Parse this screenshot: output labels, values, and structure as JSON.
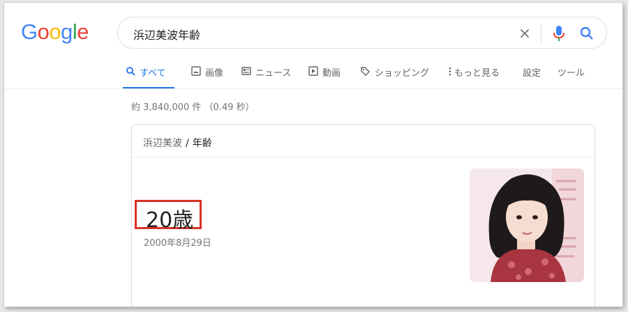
{
  "logo": {
    "text": "Google",
    "colors": [
      "#4285F4",
      "#EA4335",
      "#FBBC05",
      "#4285F4",
      "#34A853",
      "#EA4335"
    ]
  },
  "search": {
    "value": "浜辺美波年齢"
  },
  "tabs": {
    "all": "すべて",
    "images": "画像",
    "news": "ニュース",
    "videos": "動画",
    "shopping": "ショッピング",
    "more": "もっと見る",
    "settings": "設定",
    "tools": "ツール"
  },
  "result_stats": "約 3,840,000 件 （0.49 秒）",
  "card": {
    "breadcrumb_parent": "浜辺美波",
    "breadcrumb_separator": "/",
    "breadcrumb_current": "年齢",
    "answer": "20歳",
    "birth_date": "2000年8月29日"
  },
  "colors": {
    "accent": "#1a73e8",
    "highlight_border": "#d93025",
    "muted_text": "#70757a"
  }
}
